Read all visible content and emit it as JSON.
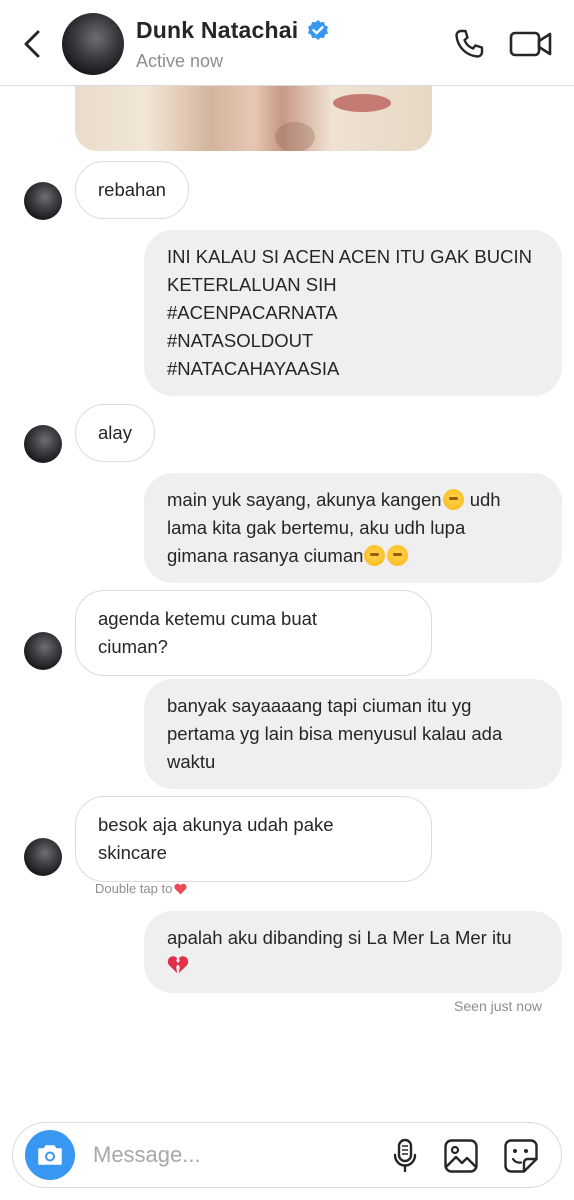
{
  "header": {
    "contact_name": "Dunk Natachai",
    "status": "Active now",
    "icons": [
      "back-arrow-icon",
      "verified-badge-icon",
      "phone-icon",
      "video-camera-icon"
    ]
  },
  "messages": [
    {
      "direction": "incoming",
      "text": "rebahan"
    },
    {
      "direction": "outgoing",
      "lines": [
        "INI KALAU SI ACEN ACEN ITU GAK BUCIN",
        "KETERLALUAN SIH",
        "#ACENPACARNATA",
        "#NATASOLDOUT",
        "#NATACAHAYAASIA"
      ]
    },
    {
      "direction": "incoming",
      "text": "alay"
    },
    {
      "direction": "outgoing",
      "lines": [
        "main yuk sayang, akunya kangen",
        "lama kita gak bertemu, aku udh lupa",
        "gimana rasanya ciuman"
      ],
      "line1_suffix": " udh",
      "emojis": [
        "pleading-face",
        "face-with-hand-over-mouth",
        "face-with-hand-over-mouth"
      ]
    },
    {
      "direction": "incoming",
      "lines": [
        "agenda ketemu cuma buat",
        "ciuman?"
      ]
    },
    {
      "direction": "outgoing",
      "lines": [
        "banyak sayaaaang tapi ciuman itu yg",
        "pertama yg lain bisa menyusul kalau ada",
        "waktu"
      ]
    },
    {
      "direction": "incoming",
      "lines": [
        "besok aja akunya udah pake",
        "skincare"
      ]
    },
    {
      "direction": "outgoing",
      "lines": [
        "apalah aku dibanding si La Mer La Mer itu"
      ],
      "emojis": [
        "broken-heart"
      ]
    }
  ],
  "hint": {
    "text": "Double tap to",
    "icon": "red-heart-icon"
  },
  "seen_label": "Seen just now",
  "composer": {
    "placeholder": "Message...",
    "icons": [
      "camera-icon",
      "microphone-icon",
      "gallery-icon",
      "sticker-icon"
    ]
  },
  "colors": {
    "accent": "#3897f0",
    "incoming_bg": "#ffffff",
    "outgoing_bg": "#efefef",
    "verified": "#3897f0",
    "heart": "#ed4956",
    "muted": "#8e8e8e"
  }
}
